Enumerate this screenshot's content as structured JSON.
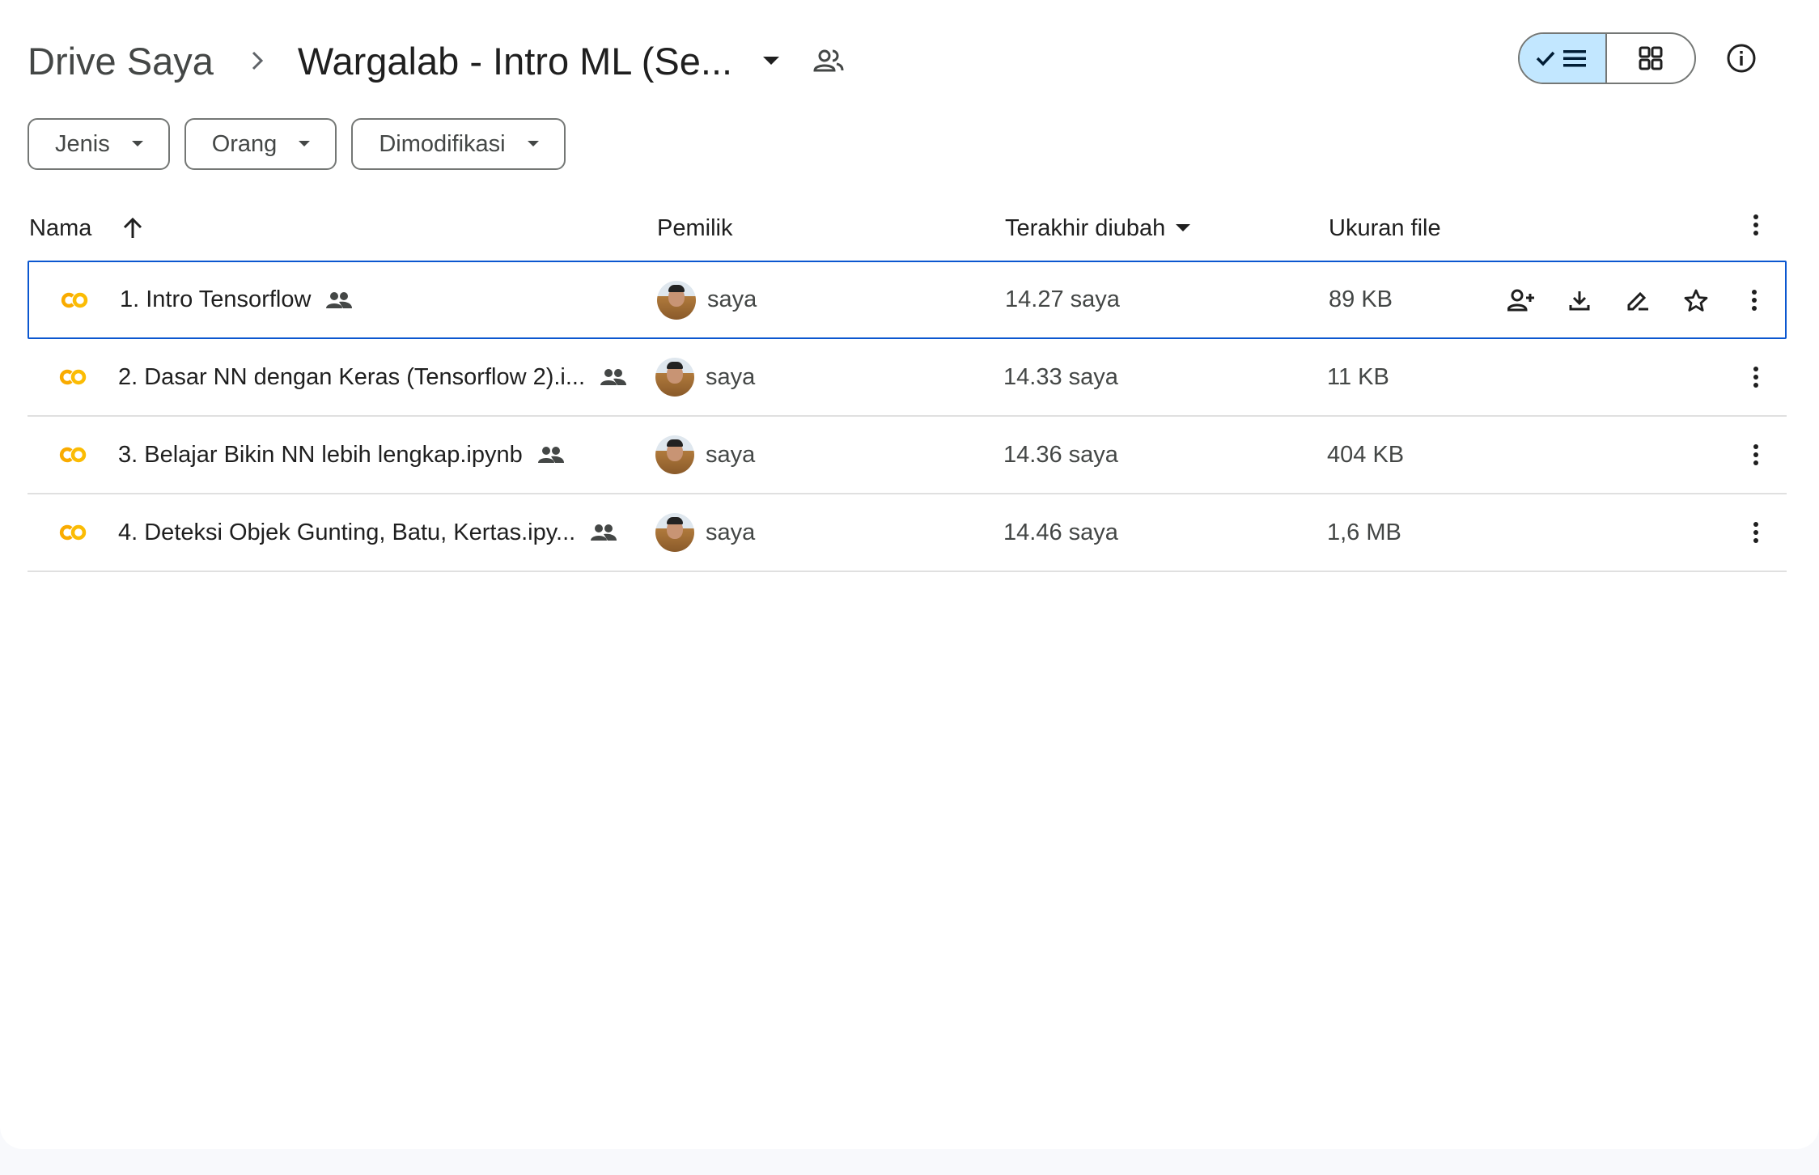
{
  "breadcrumb": {
    "root": "Drive Saya",
    "current": "Wargalab - Intro ML (Se..."
  },
  "filters": [
    {
      "label": "Jenis"
    },
    {
      "label": "Orang"
    },
    {
      "label": "Dimodifikasi"
    }
  ],
  "columns": {
    "name": "Nama",
    "owner": "Pemilik",
    "modified": "Terakhir diubah",
    "size": "Ukuran file"
  },
  "files": [
    {
      "name": "1. Intro Tensorflow",
      "owner": "saya",
      "modified": "14.27 saya",
      "size": "89 KB",
      "selected": true
    },
    {
      "name": "2. Dasar NN dengan Keras (Tensorflow 2).i...",
      "owner": "saya",
      "modified": "14.33 saya",
      "size": "11 KB"
    },
    {
      "name": "3. Belajar Bikin NN lebih lengkap.ipynb",
      "owner": "saya",
      "modified": "14.36 saya",
      "size": "404 KB"
    },
    {
      "name": "4. Deteksi Objek Gunting, Batu, Kertas.ipy...",
      "owner": "saya",
      "modified": "14.46 saya",
      "size": "1,6 MB"
    }
  ],
  "icons": {
    "file": "colab-icon",
    "shared": "shared-people-icon",
    "row_actions": [
      "share-icon",
      "download-icon",
      "rename-icon",
      "star-icon"
    ]
  },
  "colors": {
    "accent": "#0b57d0",
    "toggle_active": "#c2e7ff",
    "colab_orange": "#f9ab00",
    "colab_yellow": "#fbbc04"
  }
}
